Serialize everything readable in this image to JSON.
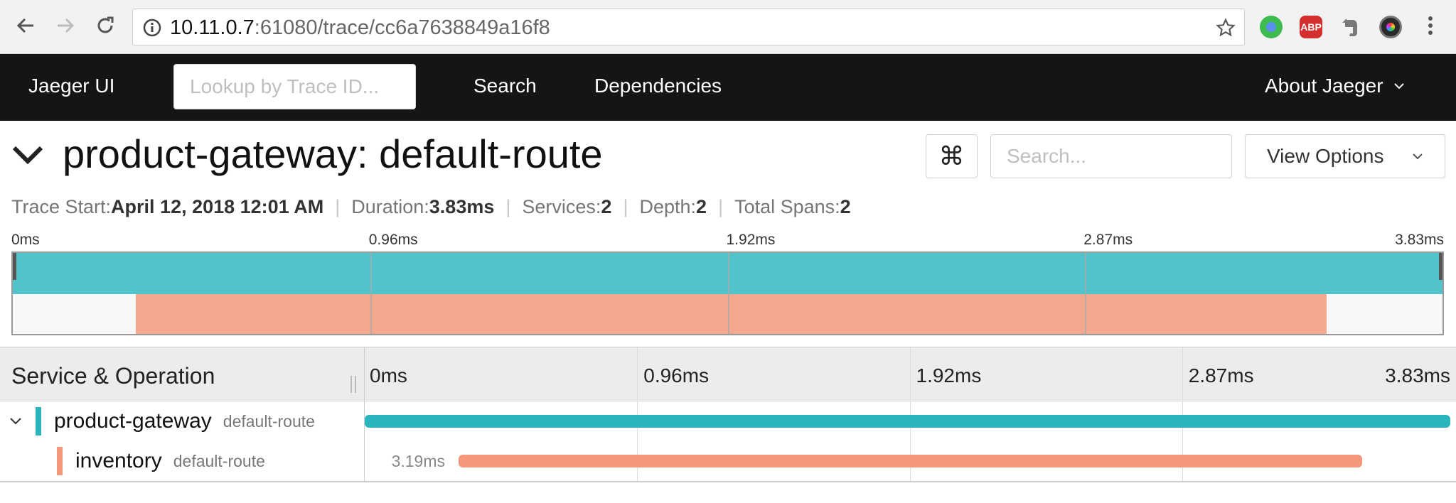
{
  "browser": {
    "url_host": "10.11.0.7",
    "url_rest": ":61080/trace/cc6a7638849a16f8",
    "extensions": [
      {
        "name": "chrome-ext-green-icon",
        "color": "#3dbb4e"
      },
      {
        "name": "adblock-plus-icon",
        "label": "ABP",
        "color": "#d32f2f"
      },
      {
        "name": "evernote-icon",
        "color": "#7a7a7a"
      },
      {
        "name": "color-picker-icon",
        "color": "#2a2a2a"
      }
    ]
  },
  "nav": {
    "brand": "Jaeger UI",
    "lookup_placeholder": "Lookup by Trace ID...",
    "search": "Search",
    "dependencies": "Dependencies",
    "about": "About Jaeger"
  },
  "trace": {
    "title": "product-gateway: default-route",
    "search_placeholder": "Search...",
    "kbd_glyph": "⌘",
    "view_options": "View Options",
    "meta": [
      {
        "label": "Trace Start:",
        "value": "April 12, 2018 12:01 AM"
      },
      {
        "label": "Duration:",
        "value": "3.83ms"
      },
      {
        "label": "Services:",
        "value": "2"
      },
      {
        "label": "Depth:",
        "value": "2"
      },
      {
        "label": "Total Spans:",
        "value": "2"
      }
    ]
  },
  "ticks": [
    "0ms",
    "0.96ms",
    "1.92ms",
    "2.87ms",
    "3.83ms"
  ],
  "timeline": {
    "header": "Service & Operation",
    "total_ms": 3.83
  },
  "spans": [
    {
      "service": "product-gateway",
      "operation": "default-route",
      "start_ms": 0,
      "duration_ms": 3.83,
      "color": "#2ab5bd",
      "light": "#50c3cb",
      "depth": 0,
      "collapsible": true
    },
    {
      "service": "inventory",
      "operation": "default-route",
      "start_ms": 0.33,
      "duration_ms": 3.19,
      "duration_label": "3.19ms",
      "color": "#f4977a",
      "light": "#f4a88e",
      "depth": 1,
      "collapsible": false
    }
  ],
  "colors": {
    "nav_bg": "#151515",
    "accent_teal": "#2ab5bd",
    "accent_salmon": "#f4977a"
  }
}
